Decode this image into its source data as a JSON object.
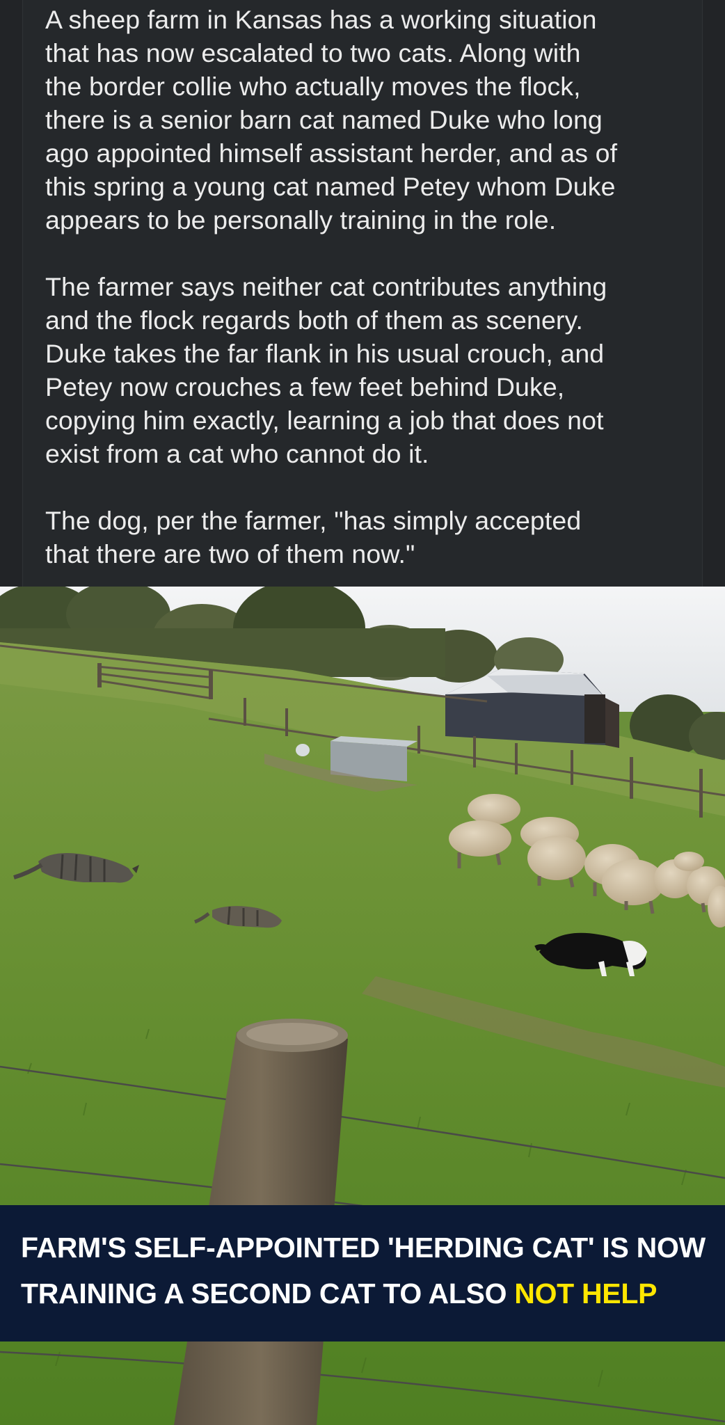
{
  "post": {
    "paragraphs": [
      "A sheep farm in Kansas has a working situation\nthat has now escalated to two cats. Along with\nthe border collie who actually moves the flock,\nthere is a senior barn cat named Duke who long\nago appointed himself assistant herder, and as of\nthis spring a young cat named Petey whom Duke\nappears to be personally training in the role.",
      "The farmer says neither cat contributes anything\nand the flock regards both of them as scenery.\nDuke takes the far flank in his usual crouch, and\nPetey now crouches a few feet behind Duke,\ncopying him exactly, learning a job that does not\nexist from a cat who cannot do it.",
      "The dog, per the farmer, \"has simply accepted\nthat there are two of them now.\""
    ]
  },
  "photo": {
    "description_icons": [
      "barn",
      "sheep-flock",
      "border-collie",
      "tabby-cat",
      "tabby-cat",
      "fence-post",
      "water-trough"
    ]
  },
  "banner": {
    "line1": "FARM'S SELF-APPOINTED 'HERDING CAT' IS NOW",
    "line2_prefix": "TRAINING A SECOND CAT TO ALSO ",
    "line2_highlight": "NOT HELP",
    "background_color": "#0c1a36",
    "highlight_color": "#ffe600"
  }
}
